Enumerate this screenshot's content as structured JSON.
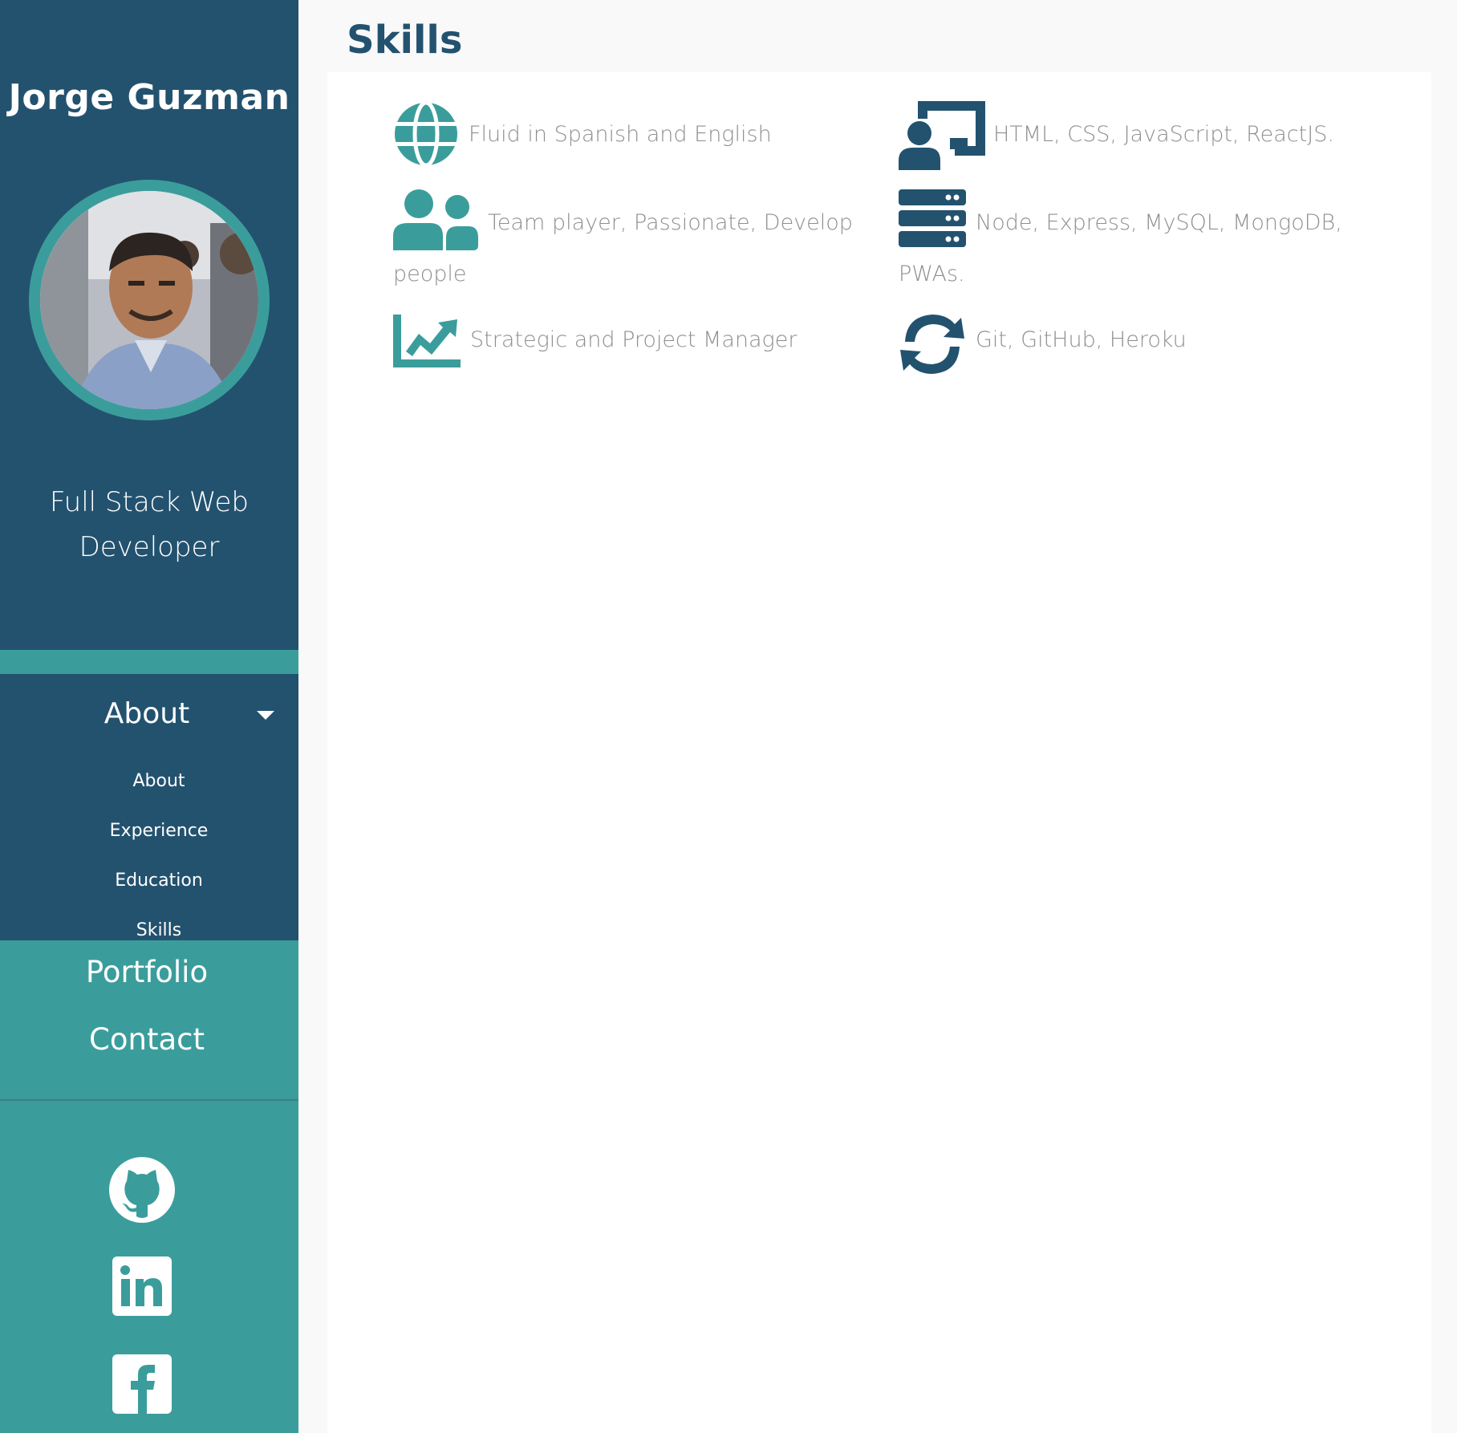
{
  "sidebar": {
    "brand": "Jorge Guzman",
    "role_line1": "Full Stack Web",
    "role_line2": "Developer",
    "nav": {
      "about_toggle": "About",
      "sub_items": [
        "About",
        "Experience",
        "Education",
        "Skills"
      ],
      "portfolio": "Portfolio",
      "contact": "Contact"
    },
    "social_icons": [
      "github-icon",
      "linkedin-icon",
      "facebook-icon"
    ]
  },
  "main": {
    "title": "Skills",
    "skills": [
      {
        "icon": "globe-icon",
        "text": "Fluid in Spanish and English"
      },
      {
        "icon": "teacher-board-icon",
        "text": "HTML, CSS, JavaScript, ReactJS."
      },
      {
        "icon": "users-icon",
        "text": "Team player, Passionate, Develop",
        "text2": "people"
      },
      {
        "icon": "server-icon",
        "text": "Node, Express, MySQL, MongoDB,",
        "text2": "PWAs."
      },
      {
        "icon": "chart-line-icon",
        "text": "Strategic and Project Manager"
      },
      {
        "icon": "sync-icon",
        "text": "Git, GitHub, Heroku"
      }
    ]
  },
  "colors": {
    "navy": "#23526f",
    "teal": "#3b9d9b",
    "text_gray": "#8f8f8f",
    "background": "#f9f9f9",
    "card": "#ffffff"
  }
}
